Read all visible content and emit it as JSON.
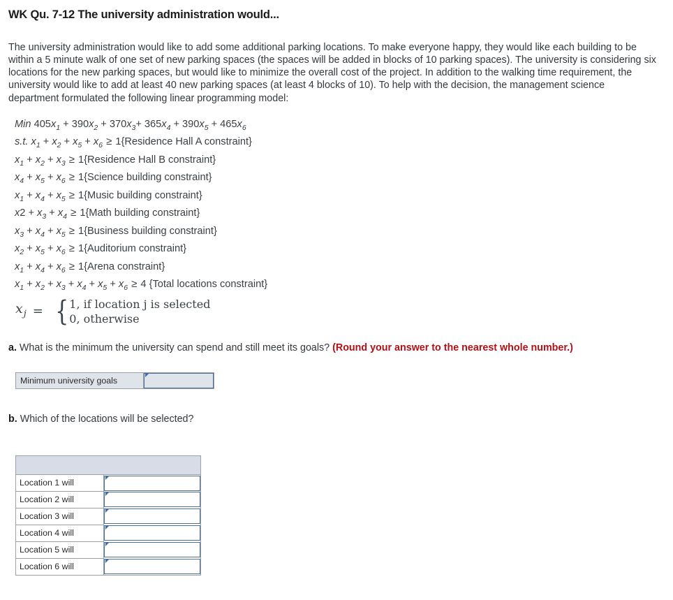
{
  "header": {
    "title": "WK Qu. 7-12 The university administration would..."
  },
  "intro": {
    "paragraph": "The university administration would like to add some additional parking locations. To make everyone happy, they would like each building to be within a 5 minute walk of one set of new parking spaces (the spaces will be added in blocks of 10 parking spaces). The university is considering six locations for the new parking spaces, but would like to minimize the overall cost of the project. In addition to the walking time requirement, the university would like to add at least 40 new parking spaces (at least 4 blocks of 10). To help with the decision, the management science department formulated the following linear programming model:"
  },
  "model": {
    "objective_label": "Min",
    "objective_terms": "405x1 + 390x2 + 370x3+ 365x4 + 390x5 + 465x6",
    "subject_to_label": "s.t.",
    "constraints": [
      {
        "lhs": "x1 + x2 + x5 + x6",
        "op": "≥",
        "rhs": "1",
        "name": "{Residence Hall A constraint}"
      },
      {
        "lhs": "x1 + x2 + x3",
        "op": "≥",
        "rhs": "1",
        "name": "{Residence Hall B constraint}"
      },
      {
        "lhs": "x4 + x5 + x6",
        "op": "≥",
        "rhs": "1",
        "name": "{Science building constraint}"
      },
      {
        "lhs": "x1 + x4 + x5",
        "op": "≥",
        "rhs": "1",
        "name": "{Music building constraint}"
      },
      {
        "lhs": "x2 + x3 + x4",
        "op": "≥",
        "rhs": "1",
        "name": "{Math building constraint}"
      },
      {
        "lhs": "x3 + x4 + x5",
        "op": "≥",
        "rhs": "1",
        "name": "{Business building constraint}"
      },
      {
        "lhs": "x2 + x5 + x6",
        "op": "≥",
        "rhs": "1",
        "name": "{Auditorium constraint}"
      },
      {
        "lhs": "x1 + x4 + x6",
        "op": "≥",
        "rhs": "1",
        "name": "{Arena constraint}"
      },
      {
        "lhs": "x1 + x2 + x3 + x4 + x5 + x6",
        "op": "≥",
        "rhs": "4",
        "name": "{Total locations constraint}"
      }
    ],
    "definition": {
      "variable": "x",
      "subscript": "j",
      "equals": "=",
      "case_one": "1, if location j is selected",
      "case_zero": "0, otherwise"
    }
  },
  "question_a": {
    "marker": "a.",
    "text": "What is the minimum the university can spend and still meet its goals?",
    "note": "(Round your answer to the nearest whole number.)",
    "note_color": "#b01116",
    "row_label": "Minimum university goals",
    "input_value": "",
    "input_placeholder": ""
  },
  "question_b": {
    "marker": "b.",
    "text": "Which of the locations will be selected?",
    "table": {
      "header": [
        ""
      ],
      "rows": [
        {
          "label": "Location 1 will",
          "value": ""
        },
        {
          "label": "Location 2 will",
          "value": ""
        },
        {
          "label": "Location 3 will",
          "value": ""
        },
        {
          "label": "Location 4 will",
          "value": ""
        },
        {
          "label": "Location 5 will",
          "value": ""
        },
        {
          "label": "Location 6 will",
          "value": ""
        }
      ]
    }
  }
}
